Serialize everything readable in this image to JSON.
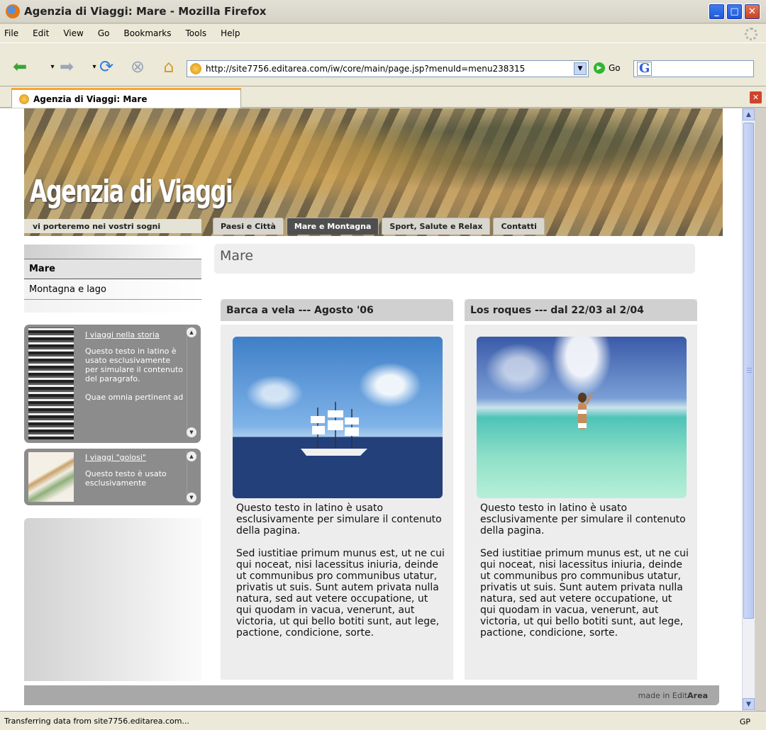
{
  "window": {
    "title": "Agenzia di Viaggi: Mare - Mozilla Firefox"
  },
  "menu": [
    "File",
    "Edit",
    "View",
    "Go",
    "Bookmarks",
    "Tools",
    "Help"
  ],
  "navigation": {
    "url": "http://site7756.editarea.com/iw/core/main/page.jsp?menuId=menu238315",
    "go_label": "Go",
    "search_engine": "G"
  },
  "tab": {
    "title": "Agenzia di Viaggi: Mare"
  },
  "site": {
    "logo": "Agenzia di Viaggi",
    "tagline": "vi porteremo nei vostri sogni",
    "topnav": [
      "Paesi e Città",
      "Mare e Montagna",
      "Sport, Salute e Relax",
      "Contatti"
    ],
    "topnav_active": "Mare e Montagna",
    "side_menu": [
      "Mare",
      "Montagna e lago"
    ],
    "side_menu_active": "Mare",
    "boxes": [
      {
        "link": "I viaggi nella storia",
        "text1": "Questo testo in latino è usato esclusivamente per simulare il contenuto del paragrafo.",
        "text2": "Quae omnia pertinent ad"
      },
      {
        "link": "I viaggi \"golosi\"",
        "text1": "Questo testo è usato esclusivamente"
      }
    ],
    "section_title": "Mare",
    "cards": [
      {
        "title": "Barca a vela --- Agosto '06",
        "p1": "Questo testo in latino è usato esclusivamente per simulare il contenuto della pagina.",
        "p2": "Sed iustitiae primum munus est, ut ne cui qui noceat, nisi lacessitus iniuria, deinde ut communibus pro communibus utatur, privatis ut suis. Sunt autem privata nulla natura, sed aut vetere occupatione, ut qui quodam in vacua, venerunt, aut victoria, ut qui bello botiti sunt, aut lege, pactione, condicione, sorte."
      },
      {
        "title": "Los roques --- dal 22/03 al 2/04",
        "p1": "Questo testo in latino è usato esclusivamente per simulare il contenuto della pagina.",
        "p2": "Sed iustitiae primum munus est, ut ne cui qui noceat, nisi lacessitus iniuria, deinde ut communibus pro communibus utatur, privatis ut suis. Sunt autem privata nulla natura, sed aut vetere occupatione, ut qui quodam in vacua, venerunt, aut victoria, ut qui bello botiti sunt, aut lege, pactione, condicione, sorte."
      }
    ],
    "footer_prefix": "made in Edit",
    "footer_brand": "Area"
  },
  "status": {
    "text": "Transferring data from site7756.editarea.com...",
    "right": "GP"
  }
}
